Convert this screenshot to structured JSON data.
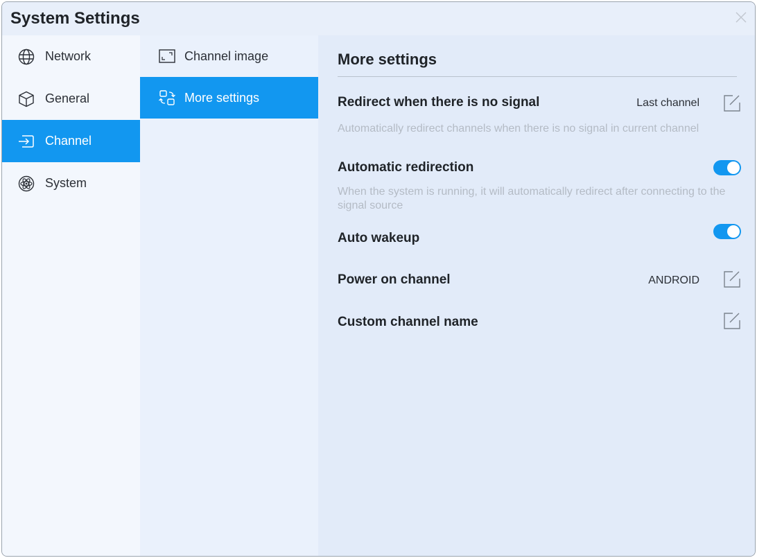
{
  "window": {
    "title": "System Settings"
  },
  "nav1": {
    "items": [
      {
        "label": "Network",
        "icon": "globe-icon",
        "active": false
      },
      {
        "label": "General",
        "icon": "cube-icon",
        "active": false
      },
      {
        "label": "Channel",
        "icon": "channel-input-icon",
        "active": true
      },
      {
        "label": "System",
        "icon": "atom-icon",
        "active": false
      }
    ]
  },
  "nav2": {
    "items": [
      {
        "label": "Channel image",
        "icon": "screen-frame-icon",
        "active": false
      },
      {
        "label": "More settings",
        "icon": "swap-squares-icon",
        "active": true
      }
    ]
  },
  "content": {
    "title": "More settings",
    "rows": [
      {
        "title": "Redirect when there is no signal",
        "value": "Last channel",
        "control": "edit",
        "description": "Automatically redirect channels when there is no signal in current channel"
      },
      {
        "title": "Automatic redirection",
        "control": "toggle",
        "on": true,
        "description": "When the system is running, it will automatically redirect after connecting to the signal source"
      },
      {
        "title": "Auto wakeup",
        "control": "toggle",
        "on": true
      },
      {
        "title": "Power on channel",
        "value": "ANDROID",
        "control": "edit"
      },
      {
        "title": "Custom channel name",
        "control": "edit"
      }
    ]
  },
  "colors": {
    "accent": "#1297f0",
    "background": "#e2ebf9",
    "muted_text": "#b4bbc5"
  }
}
